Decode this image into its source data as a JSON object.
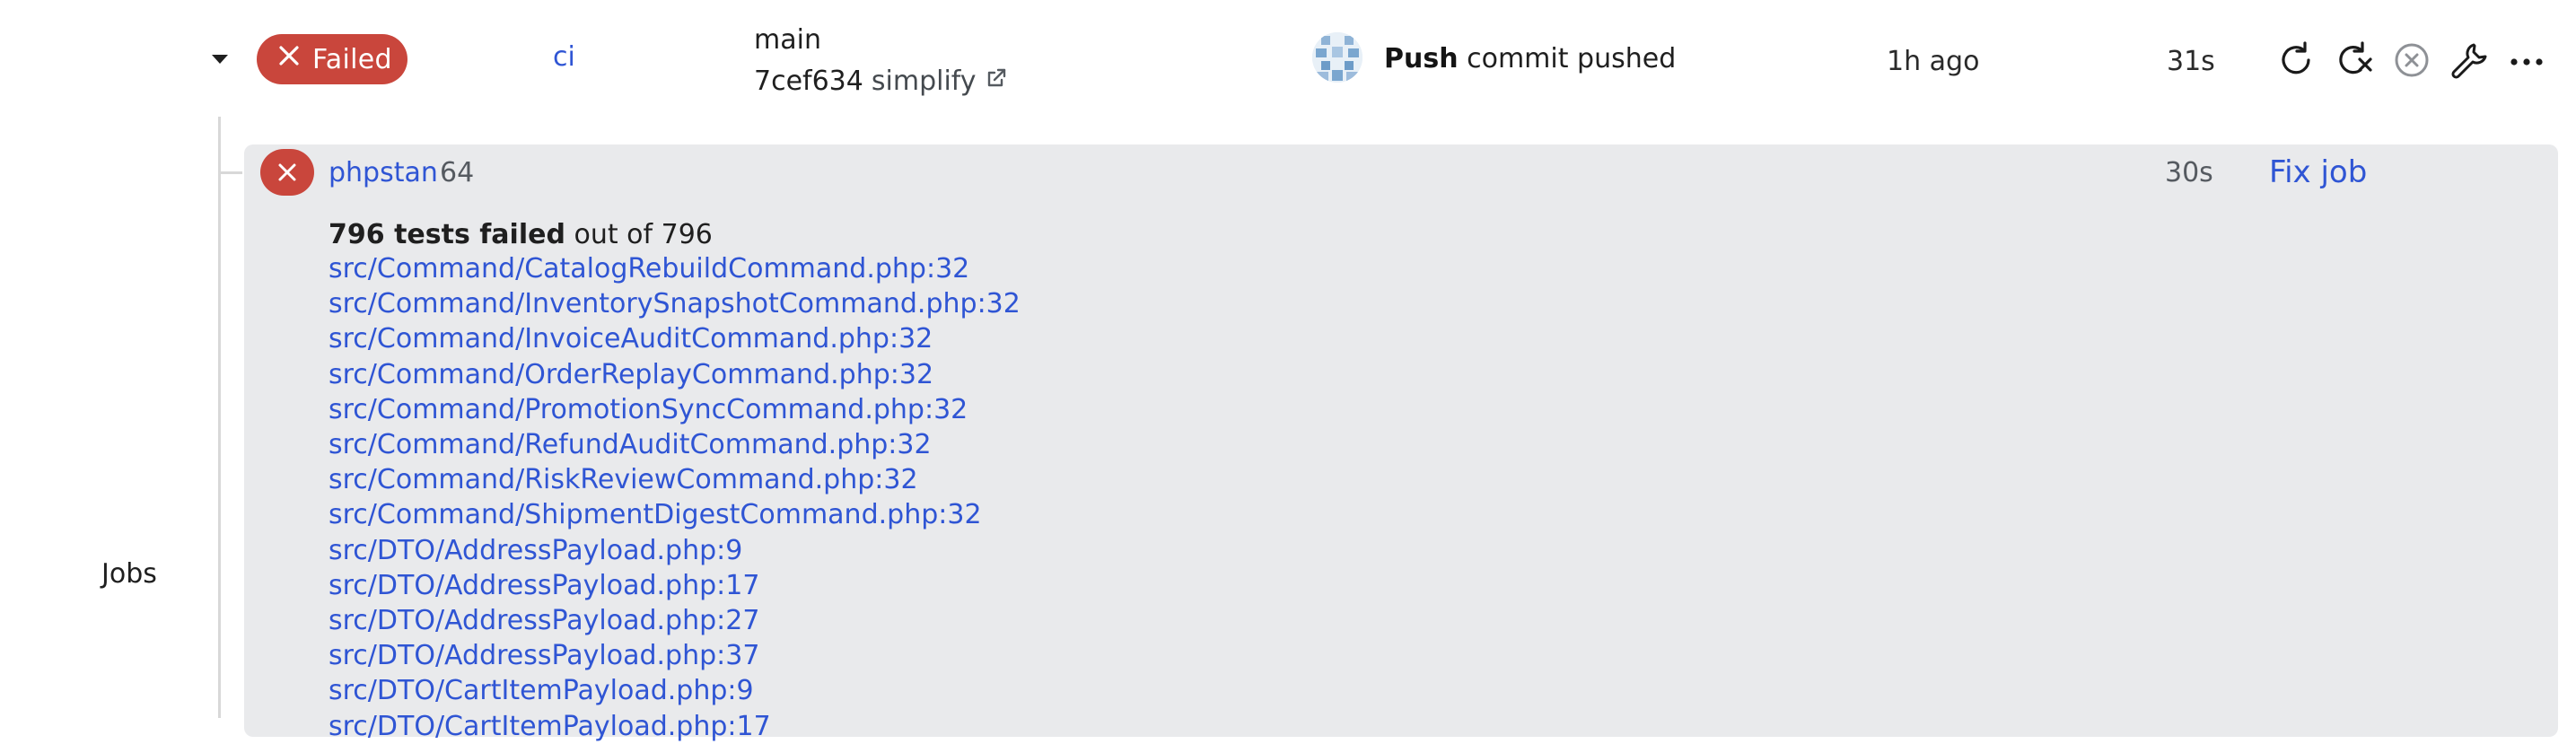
{
  "run": {
    "status": "Failed",
    "workflow": "ci",
    "branch": "main",
    "commit_hash": "7cef634",
    "commit_message": "simplify",
    "event_bold": "Push",
    "event_text": "commit pushed",
    "time_ago": "1h ago",
    "duration": "31s",
    "actions": [
      "rerun-icon",
      "rerun-failed-icon",
      "cancel-icon",
      "wrench-icon",
      "more-icon"
    ],
    "colors": {
      "failed": "#c9463c",
      "link": "#2f55d4",
      "panel": "#e9eaec"
    }
  },
  "sidebar": {
    "jobs_label": "Jobs"
  },
  "job": {
    "name": "phpstan",
    "number": "64",
    "duration": "30s",
    "fix_label": "Fix job",
    "summary_bold": "796 tests failed",
    "summary_rest": "out of 796",
    "failures": [
      "src/Command/CatalogRebuildCommand.php:32",
      "src/Command/InventorySnapshotCommand.php:32",
      "src/Command/InvoiceAuditCommand.php:32",
      "src/Command/OrderReplayCommand.php:32",
      "src/Command/PromotionSyncCommand.php:32",
      "src/Command/RefundAuditCommand.php:32",
      "src/Command/RiskReviewCommand.php:32",
      "src/Command/ShipmentDigestCommand.php:32",
      "src/DTO/AddressPayload.php:9",
      "src/DTO/AddressPayload.php:17",
      "src/DTO/AddressPayload.php:27",
      "src/DTO/AddressPayload.php:37",
      "src/DTO/CartItemPayload.php:9",
      "src/DTO/CartItemPayload.php:17"
    ]
  }
}
